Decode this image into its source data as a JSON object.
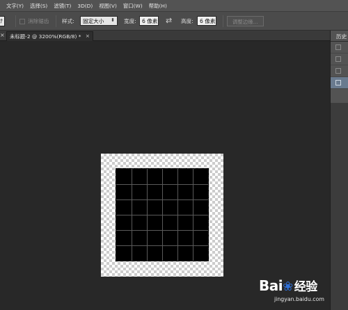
{
  "menu": {
    "items": [
      "文字(Y)",
      "选择(S)",
      "滤镜(T)",
      "3D(D)",
      "视图(V)",
      "窗口(W)",
      "帮助(H)"
    ]
  },
  "options": {
    "left_stub": "ﾅ",
    "antialias_label": "消除锯齿",
    "style_label": "样式:",
    "style_value": "固定大小",
    "width_label": "宽度:",
    "width_value": "6 像素",
    "swap_icon": "⇄",
    "height_label": "高度:",
    "height_value": "6 像素",
    "refine_button": "调整边缘..."
  },
  "tabs": {
    "left_close": "×",
    "document_title": "未标题-2 @ 3200%(RGB/8) *",
    "close": "×"
  },
  "history_panel": {
    "title": "历史",
    "rows": [
      {
        "active": false
      },
      {
        "active": false
      },
      {
        "active": false
      },
      {
        "active": true
      }
    ]
  },
  "canvas": {
    "grid_cells": 6,
    "selection_fill": "#000000",
    "grid_color": "#5a5a5a"
  },
  "watermark": {
    "logo": "Bai",
    "logo_suffix": "经验",
    "url": "jingyan.baidu.com"
  },
  "colors": {
    "menubar": "#535353",
    "optionsbar": "#4b4b4b",
    "workspace": "#282828",
    "history_active": "#6a7b8f"
  }
}
